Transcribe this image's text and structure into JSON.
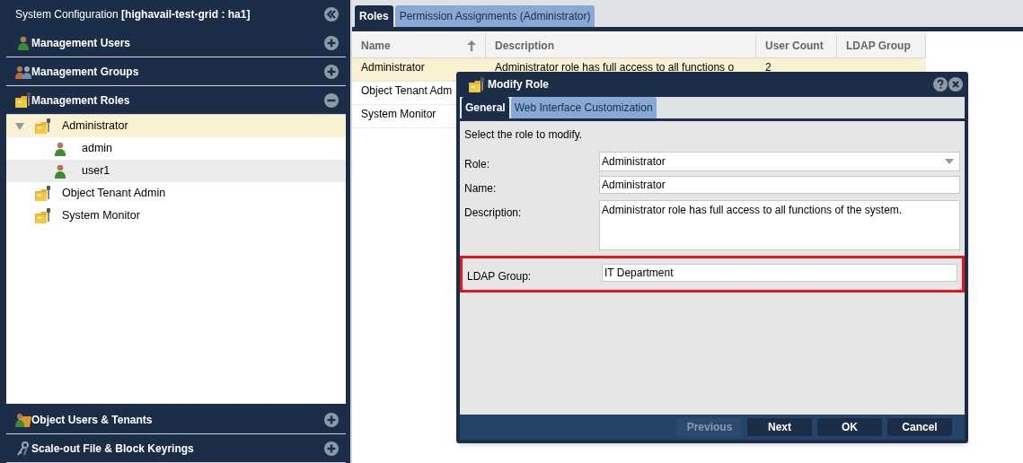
{
  "sidebar": {
    "title": "System Configuration **[highavail-test-grid : ha1]**",
    "sections": [
      {
        "label": "Management Users",
        "expanded": false
      },
      {
        "label": "Management Groups",
        "expanded": false
      },
      {
        "label": "Management Roles",
        "expanded": true,
        "tree": [
          {
            "label": "Administrator",
            "selected": true,
            "hovered": false,
            "expanded": true,
            "children": [
              {
                "label": "admin",
                "selected": false,
                "hovered": false
              },
              {
                "label": "user1",
                "selected": false,
                "hovered": true
              }
            ]
          },
          {
            "label": "Object Tenant Admin",
            "selected": false,
            "hovered": false
          },
          {
            "label": "System Monitor",
            "selected": false,
            "hovered": false
          }
        ]
      },
      {
        "label": "Object Users & Tenants",
        "expanded": false
      },
      {
        "label": "Scale-out File & Block Keyrings",
        "expanded": false
      }
    ]
  },
  "tabs": [
    {
      "label": "Roles",
      "selected": true
    },
    {
      "label": "Permission Assignments (Administrator)",
      "selected": false
    }
  ],
  "table": {
    "columns": [
      "Name",
      "Description",
      "User Count",
      "LDAP Group"
    ],
    "rows": [
      {
        "cells": [
          "Administrator",
          "Administrator role has full access to all functions o",
          "2",
          ""
        ],
        "selected": true
      },
      {
        "cells": [
          "Object Tenant Adm"
        ],
        "selected": false
      },
      {
        "cells": [
          "System Monitor"
        ],
        "selected": false
      }
    ]
  },
  "dialog": {
    "title": "Modify Role",
    "tabs": [
      {
        "label": "General",
        "selected": true
      },
      {
        "label": "Web Interface Customization",
        "selected": false
      }
    ],
    "intro": "Select the role to modify.",
    "fields": [
      {
        "kind": "dropdown",
        "label": "Role:",
        "value": "Administrator",
        "highlighted": false
      },
      {
        "kind": "text",
        "label": "Name:",
        "value": "Administrator",
        "highlighted": false
      },
      {
        "kind": "textarea",
        "label": "Description:",
        "value": "Administrator role has full access to all functions of the system.",
        "highlighted": false
      },
      {
        "kind": "text",
        "label": "LDAP Group:",
        "value": "IT Department",
        "highlighted": true
      }
    ],
    "buttons": [
      {
        "label": "Previous",
        "disabled": true
      },
      {
        "label": "Next",
        "disabled": false
      },
      {
        "label": "OK",
        "disabled": false
      },
      {
        "label": "Cancel",
        "disabled": false
      }
    ]
  }
}
